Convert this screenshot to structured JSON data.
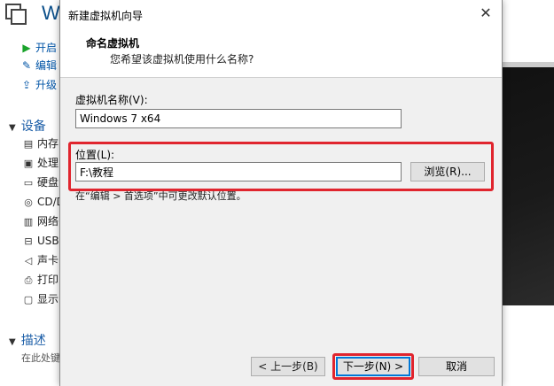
{
  "background_app": {
    "title": "W",
    "toolbar": [
      {
        "icon": "start-arrow-icon",
        "label": "开启"
      },
      {
        "icon": "edit-icon",
        "label": "编辑"
      },
      {
        "icon": "upgrade-icon",
        "label": "升级"
      }
    ],
    "devices_section": "设备",
    "devices": [
      {
        "icon": "memory-icon",
        "label": "内存"
      },
      {
        "icon": "processor-icon",
        "label": "处理"
      },
      {
        "icon": "disk-icon",
        "label": "硬盘"
      },
      {
        "icon": "cd-icon",
        "label": "CD/D"
      },
      {
        "icon": "network-icon",
        "label": "网络"
      },
      {
        "icon": "usb-icon",
        "label": "USB"
      },
      {
        "icon": "sound-icon",
        "label": "声卡"
      },
      {
        "icon": "printer-icon",
        "label": "打印"
      },
      {
        "icon": "display-icon",
        "label": "显示"
      }
    ],
    "description_section": "描述",
    "description_text": "在此处键"
  },
  "dialog": {
    "title": "新建虚拟机向导",
    "close_glyph": "✕",
    "header_title": "命名虚拟机",
    "header_subtitle": "您希望该虚拟机使用什么名称?",
    "vm_name_label": "虚拟机名称(V):",
    "vm_name_value": "Windows 7 x64",
    "location_label": "位置(L):",
    "location_value": "F:\\教程",
    "browse_button": "浏览(R)...",
    "hint": "在“编辑 > 首选项”中可更改默认位置。",
    "back_button": "< 上一步(B)",
    "next_button": "下一步(N) >",
    "cancel_button": "取消"
  },
  "colors": {
    "highlight_box": "#e0252e",
    "accent": "#0078d7",
    "link_blue": "#0054a6"
  }
}
